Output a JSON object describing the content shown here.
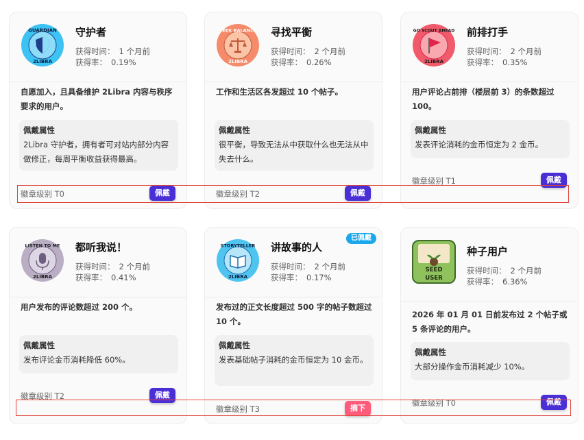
{
  "labels": {
    "time_label": "获得时间：",
    "rate_label": "获得率：",
    "attr_title": "佩戴属性"
  },
  "cards": [
    {
      "title": "守护者",
      "badge_text_top": "GUARDIAN",
      "badge_text_bottom": "2LIBRA",
      "time": "1 个月前",
      "rate": "0.19%",
      "desc": "自愿加入，且具备维护 2Libra 内容与秩序要求的用户。",
      "attr": "2Libra 守护者，拥有者可对站内部分内容做修正，每周平衡收益获得最高。",
      "level": "徽章级别 T0",
      "button": "佩戴",
      "colors": {
        "ring": "#3cc2f3",
        "inner": "#8fdcf8",
        "text": "#0d1b3d",
        "accent": "#1f3d8a"
      }
    },
    {
      "title": "寻找平衡",
      "badge_text_top": "SEEK BALANCE",
      "badge_text_bottom": "2LIBRA",
      "time": "2 个月前",
      "rate": "0.26%",
      "desc": "工作和生活区各发超过 10 个帖子。",
      "attr": "很平衡，导致无法从中获取什么也无法从中失去什么。",
      "level": "徽章级别 T2",
      "button": "佩戴",
      "colors": {
        "ring": "#f58b6a",
        "inner": "#fbc4a6",
        "text": "#ffffff",
        "accent": "#c05a38"
      }
    },
    {
      "title": "前排打手",
      "badge_text_top": "GO SCOUT AHEAD",
      "badge_text_bottom": "2LIBRA",
      "time": "2 个月前",
      "rate": "0.35%",
      "desc": "用户评论占前排（楼层前 3）的条数超过 100。",
      "attr": "发表评论消耗的金币恒定为 2 金币。",
      "level": "徽章级别 T1",
      "button": "佩戴",
      "colors": {
        "ring": "#f05a6a",
        "inner": "#f9a8b0",
        "text": "#1a1a1a",
        "accent": "#e0244a"
      }
    },
    {
      "title": "都听我说！",
      "badge_text_top": "LISTEN TO ME",
      "badge_text_bottom": "2LIBRA",
      "time": "2 个月前",
      "rate": "0.41%",
      "desc": "用户发布的评论数超过 200 个。",
      "attr": "发布评论金币消耗降低 60%。",
      "level": "徽章级别 T2",
      "button": "佩戴",
      "colors": {
        "ring": "#b9aec4",
        "inner": "#ddd6e4",
        "text": "#1a1a1a",
        "accent": "#6e5f80"
      }
    },
    {
      "title": "讲故事的人",
      "badge_text_top": "STORYTELLER",
      "badge_text_bottom": "2LIBRA",
      "time": "2 个月前",
      "rate": "0.17%",
      "desc": "发布过的正文长度超过 500 字的帖子数超过 10 个。",
      "attr": "发表基础帖子消耗的金币恒定为 10 金币。",
      "level": "徽章级别 T3",
      "button": "摘下",
      "tag": "已佩戴",
      "colors": {
        "ring": "#4fc4ef",
        "inner": "#b6e6fa",
        "text": "#0d1b3d",
        "accent": "#1f6fb0"
      }
    },
    {
      "title": "种子用户",
      "badge_text_top": "SEED",
      "badge_text_bottom": "USER",
      "time": "2 个月前",
      "rate": "6.36%",
      "desc": "2026 年 01 月 01 日前发布过 2 个帖子或 5 条评论的用户。",
      "attr": "大部分操作金币消耗减少 10%。",
      "level": "徽章级别 T0",
      "button": "佩戴",
      "colors": {
        "ring": "#3f6a2a",
        "inner": "#8fc25c",
        "text": "#1a2a10",
        "accent": "#f4e7c8"
      }
    }
  ]
}
